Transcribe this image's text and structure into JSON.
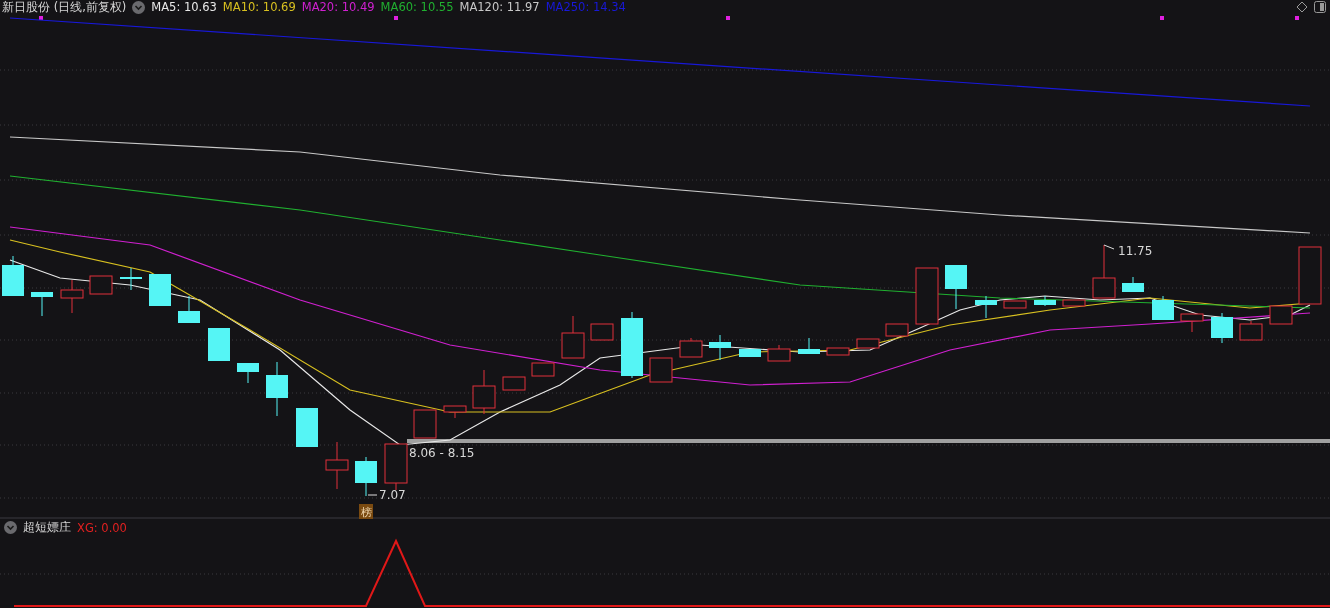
{
  "main_panel": {
    "title": "新日股份 (日线,前复权)",
    "legend": [
      {
        "label": "MA5: 10.63",
        "color": "#e8e8e8"
      },
      {
        "label": "MA10: 10.69",
        "color": "#d8c020"
      },
      {
        "label": "MA20: 10.49",
        "color": "#d020d0"
      },
      {
        "label": "MA60: 10.55",
        "color": "#20b030"
      },
      {
        "label": "MA120: 11.97",
        "color": "#c8c8c8"
      },
      {
        "label": "MA250: 14.34",
        "color": "#1818d8"
      }
    ],
    "annotations": [
      {
        "kind": "high",
        "text": "11.75"
      },
      {
        "kind": "range",
        "text": "8.06 - 8.15"
      },
      {
        "kind": "low",
        "text": "7.07"
      },
      {
        "kind": "badge",
        "text": "榜"
      }
    ]
  },
  "indicator_panel": {
    "title": "超短嫖庄",
    "reading": "XG: 0.00"
  }
}
